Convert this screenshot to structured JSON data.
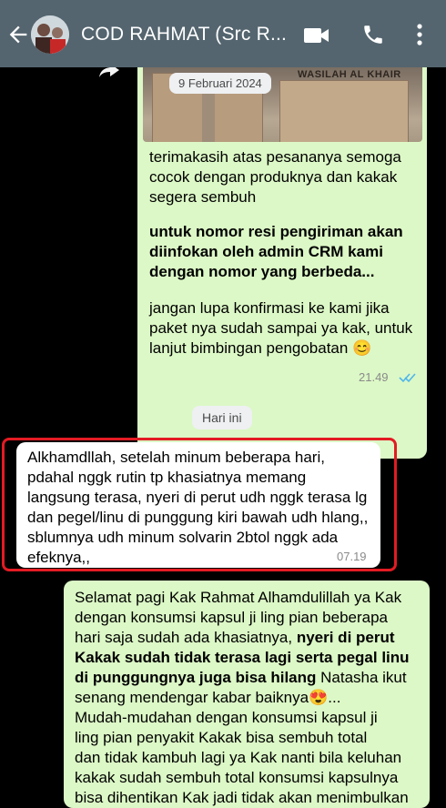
{
  "header": {
    "title": "COD RAHMAT (Src R...",
    "icons": [
      "back-arrow-icon",
      "avatar",
      "video-call-icon",
      "phone-icon",
      "more-vertical-icon"
    ]
  },
  "messages": {
    "outgoing1": {
      "image_date": "9 Februari 2024",
      "image_text": "WASILAH AL KHAIR",
      "line1": "terimakasih atas pesananya semoga",
      "line2": "cocok dengan produknya dan  kakak",
      "line3": "segera sembuh",
      "bold1": "untuk nomor resi pengiriman akan",
      "bold2": "diinfokan oleh admin CRM kami",
      "bold3": "dengan nomor yang berbeda...",
      "line4": "jangan lupa konfirmasi ke kami jika",
      "line5": "paket nya sudah sampai ya kak, untuk",
      "line6": "lanjut bimbingan pengobatan",
      "emoji": "😊",
      "time": "21.49",
      "status": "read"
    },
    "today_label": "Hari ini",
    "incoming1": {
      "line1": "Alkhamdllah,  setelah minum beberapa hari,",
      "line2": "pdahal nggk rutin tp khasiatnya memang",
      "line3": "langsung terasa, nyeri di perut udh nggk terasa lg",
      "line4": "dan pegel/linu di punggung kiri bawah udh hlang,,",
      "line5": "sblumnya udh minum solvarin 2btol nggk ada",
      "line6": "efeknya,,",
      "time": "07.19"
    },
    "outgoing2": {
      "line1": "Selamat pagi Kak Rahmat Alhamdulillah ya Kak",
      "line2": "dengan konsumsi kapsul ji ling pian beberapa",
      "line3a": "hari saja sudah ada khasiatnya, ",
      "line3b": "nyeri di perut",
      "line4": "Kakak sudah tidak terasa lagi serta pegal linu",
      "line5a": "di punggungnya juga bisa hilang",
      "line5b": " Natasha ikut",
      "line6": "senang mendengar kabar baiknya",
      "emoji": "😍",
      "line6end": "...",
      "line7": "Mudah-mudahan dengan konsumsi kapsul ji",
      "line8": "ling pian  penyakit Kakak bisa sembuh total",
      "line9": "dan tidak kambuh lagi ya Kak nanti bila keluhan",
      "line10": "kakak sudah sembuh total konsumsi kapsulnya",
      "line11": "bisa dihentikan Kak jadi tidak akan menimbulkan"
    }
  },
  "colors": {
    "header": "#54656f",
    "outgoing_bubble": "#dcf8c6",
    "incoming_bubble": "#ffffff",
    "highlight_border": "#e31b23",
    "read_ticks": "#4fb6ec"
  }
}
